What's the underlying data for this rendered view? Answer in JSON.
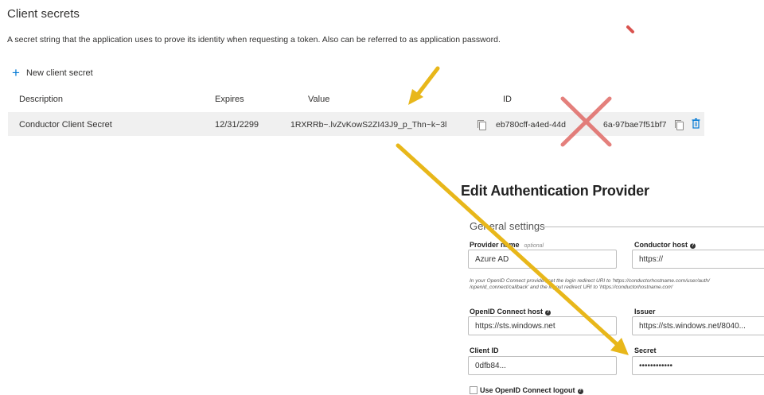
{
  "portal": {
    "title": "Client secrets",
    "description": "A secret string that the application uses to prove its identity when requesting a token. Also can be referred to as application password.",
    "new_secret_label": "New client secret",
    "table": {
      "headers": {
        "description": "Description",
        "expires": "Expires",
        "value": "Value",
        "id": "ID"
      },
      "row": {
        "description": "Conductor Client Secret",
        "expires": "12/31/2299",
        "value": "1RXRRb~.lvZvKowS2ZI43J9_p_Thn~k~3l",
        "id": "eb780cff-a4ed-44d",
        "id_tail": "6a-97bae7f51bf7"
      }
    }
  },
  "form": {
    "title": "Edit Authentication Provider",
    "section": "General settings",
    "provider_name": {
      "label": "Provider name",
      "optional": "optional",
      "value": "Azure AD"
    },
    "conductor_host": {
      "label": "Conductor host",
      "value": "https://"
    },
    "note_line1": "In your OpenID Connect provider, set the login redirect URI to 'https://conductorhostname.com/user/auth/",
    "note_line2": "/openid_connect/callback' and the logout redirect URI to 'https://conductorhostname.com'",
    "openid_host": {
      "label": "OpenID Connect host",
      "value": "https://sts.windows.net"
    },
    "issuer": {
      "label": "Issuer",
      "value": "https://sts.windows.net/8040..."
    },
    "client_id": {
      "label": "Client ID",
      "value": "0dfb84..."
    },
    "secret": {
      "label": "Secret",
      "value": "••••••••••••"
    },
    "logout_checkbox": {
      "label": "Use OpenID Connect logout",
      "checked": false
    }
  },
  "colors": {
    "accent": "#0078d4",
    "arrow": "#e8b71a",
    "cross": "#e06a66"
  }
}
